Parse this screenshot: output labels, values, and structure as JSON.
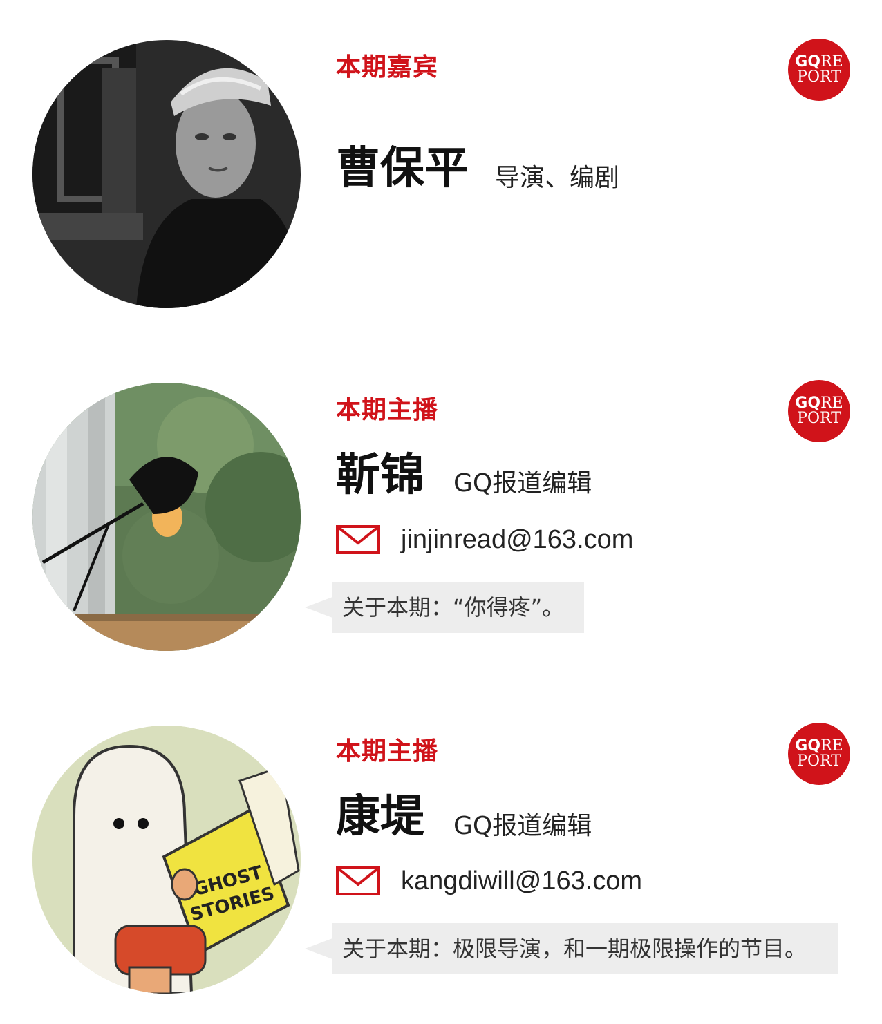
{
  "badge": {
    "line1_bold": "GQ",
    "line1_rest": "RE",
    "line2": "PORT"
  },
  "cards": [
    {
      "role": "本期嘉宾",
      "name": "曹保平",
      "title": "导演、编剧"
    },
    {
      "role": "本期主播",
      "name": "靳锦",
      "title": "GQ报道编辑",
      "email": "jinjinread@163.com",
      "note": "关于本期：“你得疼”。"
    },
    {
      "role": "本期主播",
      "name": "康堤",
      "title": "GQ报道编辑",
      "email": "kangdiwill@163.com",
      "note": "关于本期：极限导演，和一期极限操作的节目。"
    }
  ],
  "colors": {
    "accent": "#d0131a",
    "bubble": "#ededed"
  },
  "icons": [
    "envelope-icon",
    "gq-report-badge"
  ]
}
